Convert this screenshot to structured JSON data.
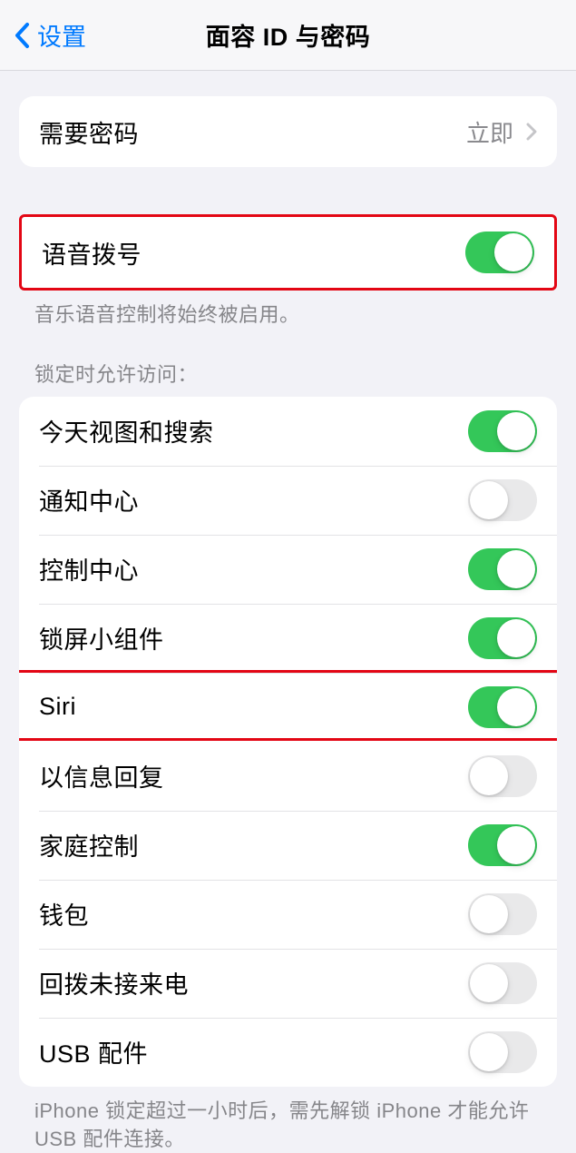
{
  "nav": {
    "back_label": "设置",
    "title": "面容 ID 与密码"
  },
  "require_passcode": {
    "label": "需要密码",
    "value": "立即"
  },
  "voice_dial": {
    "label": "语音拨号",
    "footer": "音乐语音控制将始终被启用。"
  },
  "lock_access": {
    "header": "锁定时允许访问：",
    "items": [
      {
        "label": "今天视图和搜索",
        "on": true
      },
      {
        "label": "通知中心",
        "on": false
      },
      {
        "label": "控制中心",
        "on": true
      },
      {
        "label": "锁屏小组件",
        "on": true
      },
      {
        "label": "Siri",
        "on": true
      },
      {
        "label": "以信息回复",
        "on": false
      },
      {
        "label": "家庭控制",
        "on": true
      },
      {
        "label": "钱包",
        "on": false
      },
      {
        "label": "回拨未接来电",
        "on": false
      },
      {
        "label": "USB 配件",
        "on": false
      }
    ],
    "footer": "iPhone 锁定超过一小时后，需先解锁 iPhone 才能允许 USB 配件连接。"
  }
}
